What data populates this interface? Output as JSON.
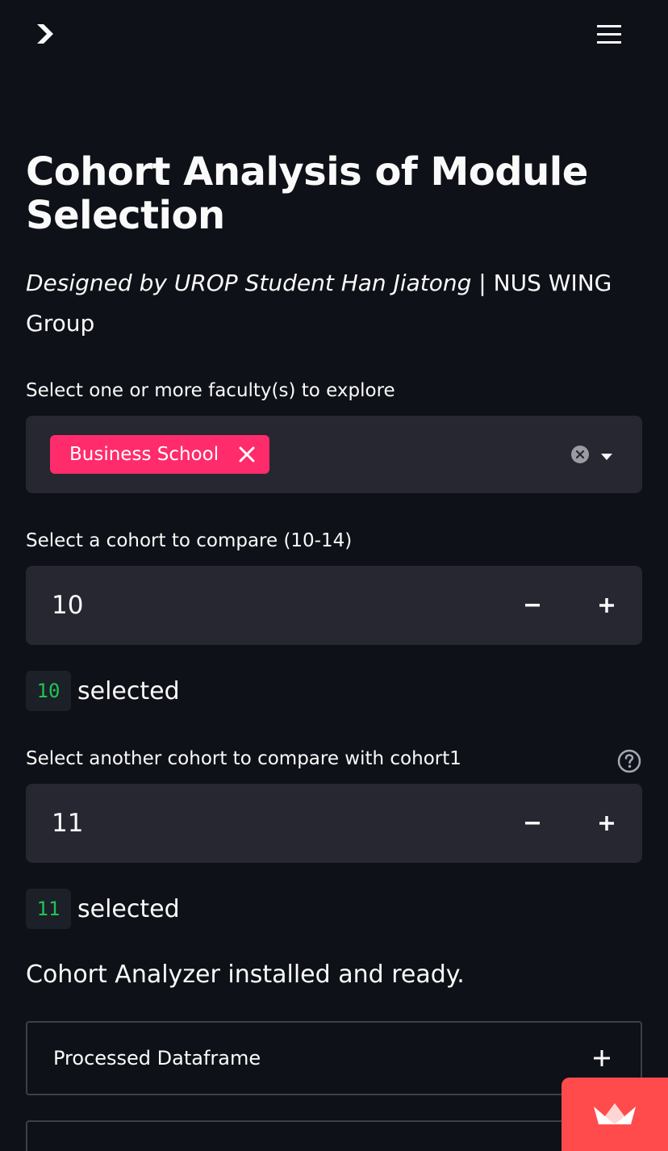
{
  "header": {
    "sidebar_toggle_icon": "chevron-right-icon",
    "menu_icon": "hamburger-menu-icon"
  },
  "main": {
    "title": "Cohort Analysis of Module Selection",
    "subtitle_italic": "Designed by UROP Student Han Jiatong",
    "subtitle_rest": " | NUS WING Group"
  },
  "faculty_select": {
    "label": "Select one or more faculty(s) to explore",
    "selected_tags": [
      "Business School"
    ],
    "clear_icon": "clear-circle-icon",
    "dropdown_icon": "caret-down-icon"
  },
  "cohort1": {
    "label": "Select a cohort to compare (10-14)",
    "value": "10",
    "minus_label": "−",
    "plus_label": "+",
    "selected_value": "10",
    "selected_text": "selected"
  },
  "cohort2": {
    "label": "Select another cohort to compare with cohort1",
    "help_icon": "question-circle-icon",
    "value": "11",
    "minus_label": "−",
    "plus_label": "+",
    "selected_value": "11",
    "selected_text": "selected"
  },
  "status": {
    "text": "Cohort Analyzer installed and ready."
  },
  "expanders": [
    {
      "label": "Processed Dataframe",
      "icon": "plus-icon"
    }
  ],
  "colors": {
    "background": "#0e1117",
    "widget_bg": "#262730",
    "tag": "#ff2b6b",
    "code_green": "#21c354",
    "streamlit_badge": "#ff4b4b"
  }
}
